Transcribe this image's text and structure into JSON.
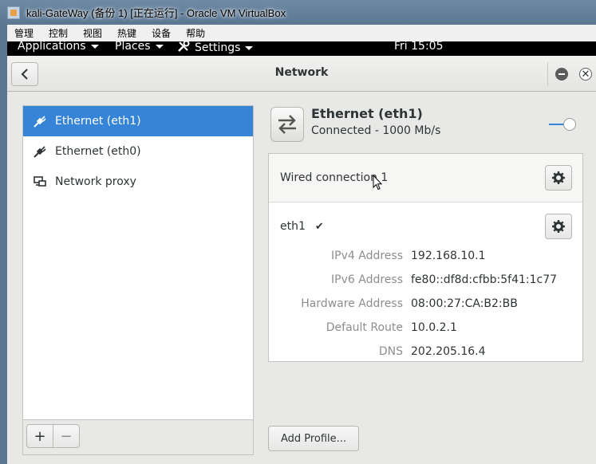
{
  "vbox": {
    "title": "kali-GateWay (备份 1) [正在运行] - Oracle VM VirtualBox",
    "menu": [
      "管理",
      "控制",
      "视图",
      "热键",
      "设备",
      "帮助"
    ]
  },
  "topbar": {
    "applications": "Applications",
    "places": "Places",
    "settings": "Settings",
    "clock": "Fri 15:05"
  },
  "header": {
    "title": "Network"
  },
  "sidebar": {
    "items": [
      {
        "label": "Ethernet (eth1)",
        "icon": "ethernet-icon",
        "selected": true
      },
      {
        "label": "Ethernet (eth0)",
        "icon": "ethernet-icon",
        "selected": false
      },
      {
        "label": "Network proxy",
        "icon": "network-proxy-icon",
        "selected": false
      }
    ],
    "add_label": "+",
    "remove_label": "−"
  },
  "device": {
    "name": "Ethernet (eth1)",
    "status": "Connected - 1000 Mb/s",
    "enabled": true
  },
  "connection": {
    "profile_name": "Wired connection 1",
    "interface": "eth1",
    "details": [
      {
        "key": "IPv4 Address",
        "value": "192.168.10.1"
      },
      {
        "key": "IPv6 Address",
        "value": "fe80::df8d:cfbb:5f41:1c77"
      },
      {
        "key": "Hardware Address",
        "value": "08:00:27:CA:B2:BB"
      },
      {
        "key": "Default Route",
        "value": "10.0.2.1"
      },
      {
        "key": "DNS",
        "value": "202.205.16.4"
      }
    ]
  },
  "buttons": {
    "add_profile": "Add Profile..."
  },
  "colors": {
    "accent": "#3584d7",
    "topbar": "#000000",
    "vbox_frame": "#5a7691"
  }
}
